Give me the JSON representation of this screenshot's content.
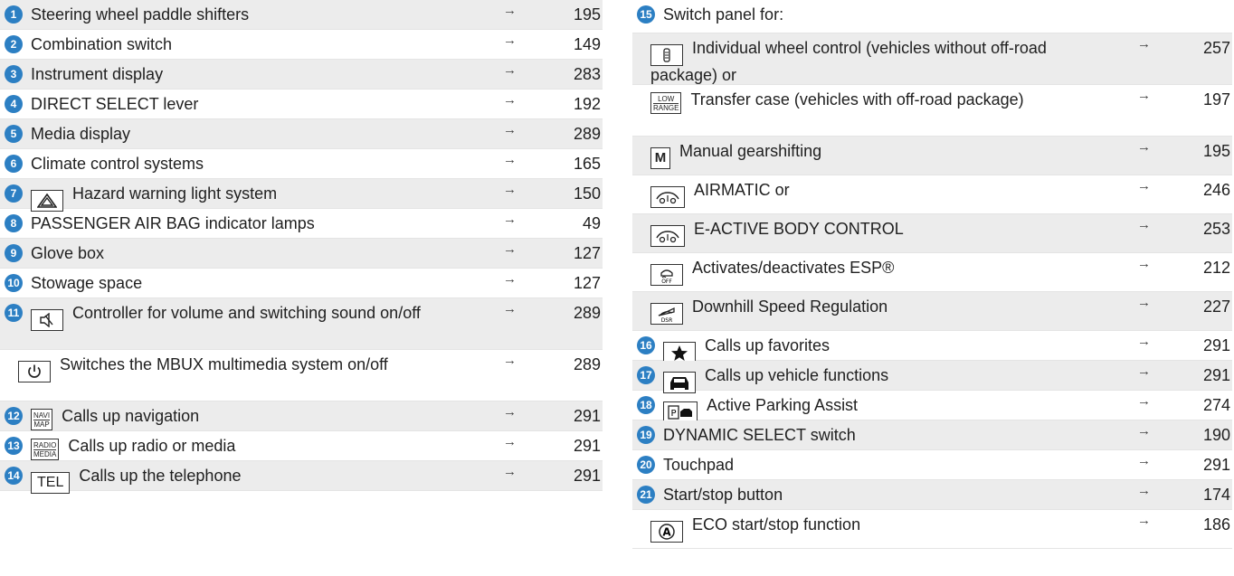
{
  "left": [
    {
      "num": "1",
      "label": "Steering wheel paddle shifters",
      "page": "195",
      "icon": null
    },
    {
      "num": "2",
      "label": "Combination switch",
      "page": "149",
      "icon": null
    },
    {
      "num": "3",
      "label": "Instrument display",
      "page": "283",
      "icon": null
    },
    {
      "num": "4",
      "label": "DIRECT SELECT lever",
      "page": "192",
      "icon": null
    },
    {
      "num": "5",
      "label": "Media display",
      "page": "289",
      "icon": null
    },
    {
      "num": "6",
      "label": "Climate control systems",
      "page": "165",
      "icon": null
    },
    {
      "num": "7",
      "label": "Hazard warning light system",
      "page": "150",
      "icon": "hazard-warning-icon"
    },
    {
      "num": "8",
      "label": "PASSENGER AIR BAG indicator lamps",
      "page": "49",
      "icon": null
    },
    {
      "num": "9",
      "label": "Glove box",
      "page": "127",
      "icon": null
    },
    {
      "num": "10",
      "label": "Stowage space",
      "page": "127",
      "icon": null
    },
    {
      "num": "11",
      "label": "Controller for volume and switching sound on/off",
      "page": "289",
      "icon": "speaker-mute-icon"
    },
    {
      "num": "",
      "label": "Switches the MBUX multimedia system on/off",
      "page": "289",
      "icon": "power-icon"
    },
    {
      "num": "12",
      "label": "Calls up navigation",
      "page": "291",
      "icon": "navi-map-icon",
      "icon_text_top": "NAVI",
      "icon_text_bottom": "MAP"
    },
    {
      "num": "13",
      "label": "Calls up radio or media",
      "page": "291",
      "icon": "radio-media-icon",
      "icon_text_top": "RADIO",
      "icon_text_bottom": "MEDIA"
    },
    {
      "num": "14",
      "label": "Calls up the telephone",
      "page": "291",
      "icon": "telephone-icon",
      "icon_text": "TEL"
    }
  ],
  "right": [
    {
      "num": "15",
      "label": "Switch panel for:",
      "page": "",
      "icon": null
    },
    {
      "num": "",
      "label": "Individual wheel control (vehicles without off-road package) or",
      "page": "257",
      "icon": "wheel-control-icon"
    },
    {
      "num": "",
      "label": "Transfer case (vehicles with off-road package)",
      "page": "197",
      "icon": "low-range-icon",
      "icon_text_top": "LOW",
      "icon_text_bottom": "RANGE"
    },
    {
      "num": "",
      "label": "Manual gearshifting",
      "page": "195",
      "icon": "manual-m-icon",
      "icon_text": "M"
    },
    {
      "num": "",
      "label": "AIRMATIC or",
      "page": "246",
      "icon": "airmatic-icon"
    },
    {
      "num": "",
      "label": "E-ACTIVE BODY CONTROL",
      "page": "253",
      "icon": "body-control-icon"
    },
    {
      "num": "",
      "label": "Activates/deactivates ESP®",
      "page": "212",
      "icon": "esp-off-icon"
    },
    {
      "num": "",
      "label": "Downhill Speed Regulation",
      "page": "227",
      "icon": "dsr-icon"
    },
    {
      "num": "16",
      "label": "Calls up favorites",
      "page": "291",
      "icon": "star-icon"
    },
    {
      "num": "17",
      "label": "Calls up vehicle functions",
      "page": "291",
      "icon": "car-icon"
    },
    {
      "num": "18",
      "label": "Active Parking Assist",
      "page": "274",
      "icon": "parking-assist-icon"
    },
    {
      "num": "19",
      "label": "DYNAMIC SELECT switch",
      "page": "190",
      "icon": null
    },
    {
      "num": "20",
      "label": "Touchpad",
      "page": "291",
      "icon": null
    },
    {
      "num": "21",
      "label": "Start/stop button",
      "page": "174",
      "icon": null
    },
    {
      "num": "",
      "label": "ECO start/stop function",
      "page": "186",
      "icon": "eco-a-icon"
    }
  ],
  "arrow_glyph": "→",
  "accent_color": "#2c7fc3"
}
